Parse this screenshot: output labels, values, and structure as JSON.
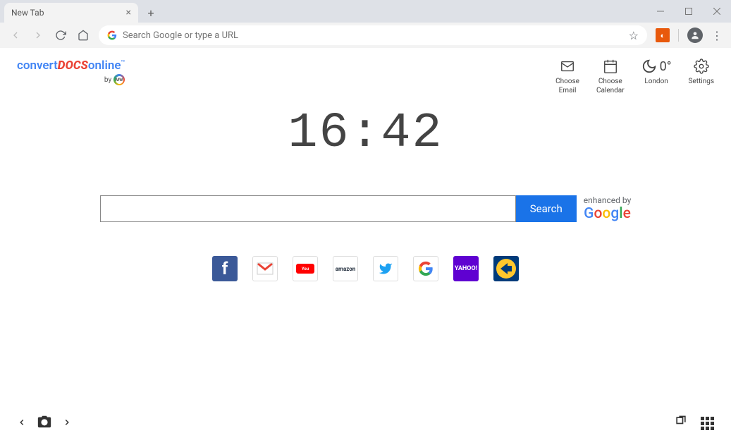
{
  "titlebar": {
    "tab_title": "New Tab"
  },
  "urlbar": {
    "placeholder": "Search Google or type a URL"
  },
  "logo": {
    "part1": "convert",
    "part2": "DOCS",
    "part3": "online",
    "by": "by"
  },
  "widgets": {
    "email_l1": "Choose",
    "email_l2": "Email",
    "calendar_l1": "Choose",
    "calendar_l2": "Calendar",
    "temp": "0°",
    "city": "London",
    "settings": "Settings"
  },
  "clock": "16:42",
  "search": {
    "button": "Search",
    "enhanced": "enhanced by"
  },
  "tiles": {
    "facebook": "f",
    "gmail": "M",
    "youtube": "YouTube",
    "amazon": "amazon",
    "twitter": "t",
    "google": "G",
    "yahoo": "YAHOO!",
    "expedia": "expedia"
  }
}
